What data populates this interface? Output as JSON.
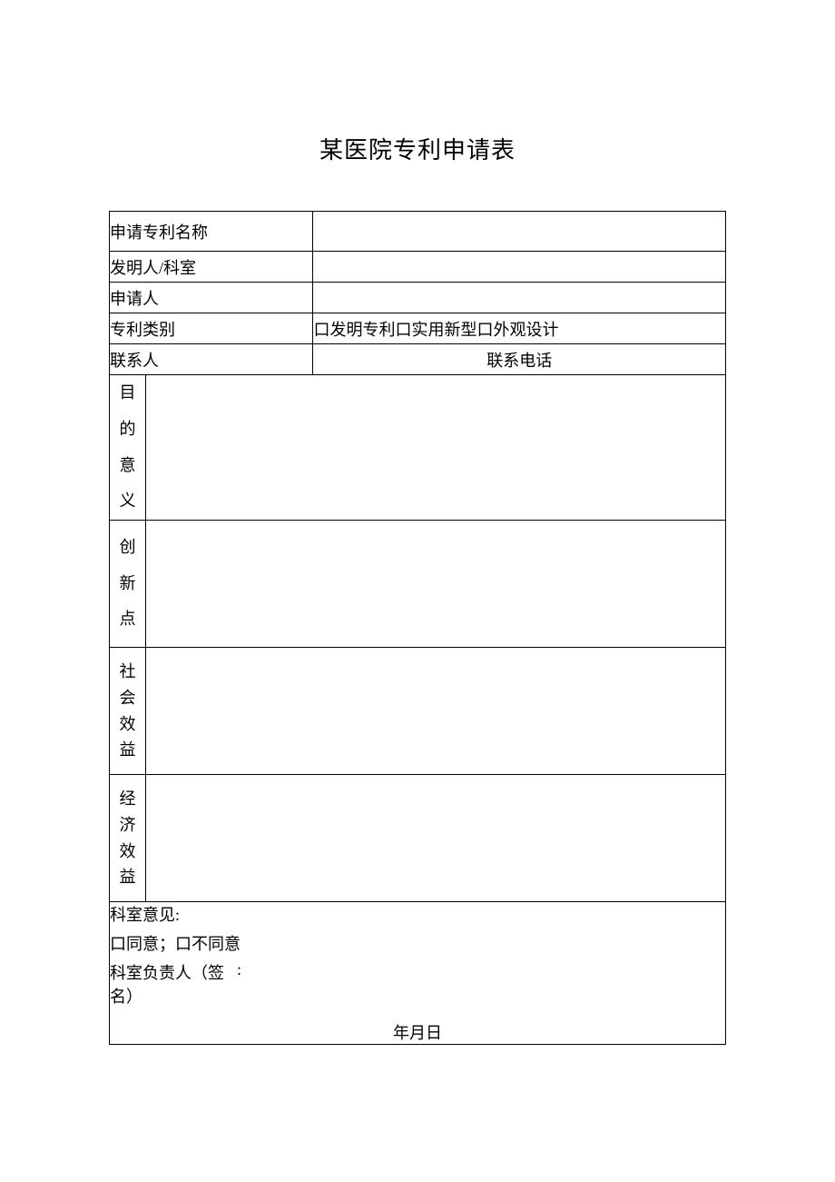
{
  "title": "某医院专利申请表",
  "rows": {
    "patent_name": {
      "label": "申请专利名称",
      "value": ""
    },
    "inventor": {
      "label": "发明人/科室",
      "value": ""
    },
    "applicant": {
      "label": "申请人",
      "value": ""
    },
    "category": {
      "label": "专利类别",
      "options_text": "口发明专利口实用新型口外观设计"
    },
    "contact": {
      "label": "联系人",
      "value": "",
      "phone_label": "联系电话",
      "phone_value": ""
    },
    "purpose": {
      "label_chars": [
        "目",
        "的",
        "意",
        "义"
      ],
      "value": ""
    },
    "innovation": {
      "label_chars": [
        "创",
        "新",
        "点"
      ],
      "value": ""
    },
    "social": {
      "label_chars": [
        "社",
        "会",
        "效",
        "益"
      ],
      "value": ""
    },
    "economic": {
      "label_chars": [
        "经",
        "济",
        "效",
        "益"
      ],
      "value": ""
    }
  },
  "opinion": {
    "heading": "科室意见:",
    "choices_text": "口同意；口不同意",
    "sign_label": "科室负责人（签名）",
    "sign_colon": ":",
    "date_text": "年月日"
  }
}
